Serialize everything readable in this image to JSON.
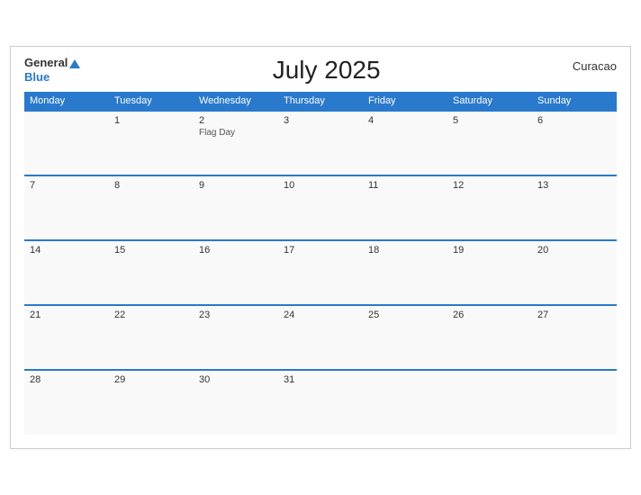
{
  "header": {
    "logo_general": "General",
    "logo_blue": "Blue",
    "title": "July 2025",
    "location": "Curacao"
  },
  "days_of_week": [
    "Monday",
    "Tuesday",
    "Wednesday",
    "Thursday",
    "Friday",
    "Saturday",
    "Sunday"
  ],
  "weeks": [
    [
      {
        "date": "",
        "holiday": ""
      },
      {
        "date": "1",
        "holiday": ""
      },
      {
        "date": "2",
        "holiday": "Flag Day"
      },
      {
        "date": "3",
        "holiday": ""
      },
      {
        "date": "4",
        "holiday": ""
      },
      {
        "date": "5",
        "holiday": ""
      },
      {
        "date": "6",
        "holiday": ""
      }
    ],
    [
      {
        "date": "7",
        "holiday": ""
      },
      {
        "date": "8",
        "holiday": ""
      },
      {
        "date": "9",
        "holiday": ""
      },
      {
        "date": "10",
        "holiday": ""
      },
      {
        "date": "11",
        "holiday": ""
      },
      {
        "date": "12",
        "holiday": ""
      },
      {
        "date": "13",
        "holiday": ""
      }
    ],
    [
      {
        "date": "14",
        "holiday": ""
      },
      {
        "date": "15",
        "holiday": ""
      },
      {
        "date": "16",
        "holiday": ""
      },
      {
        "date": "17",
        "holiday": ""
      },
      {
        "date": "18",
        "holiday": ""
      },
      {
        "date": "19",
        "holiday": ""
      },
      {
        "date": "20",
        "holiday": ""
      }
    ],
    [
      {
        "date": "21",
        "holiday": ""
      },
      {
        "date": "22",
        "holiday": ""
      },
      {
        "date": "23",
        "holiday": ""
      },
      {
        "date": "24",
        "holiday": ""
      },
      {
        "date": "25",
        "holiday": ""
      },
      {
        "date": "26",
        "holiday": ""
      },
      {
        "date": "27",
        "holiday": ""
      }
    ],
    [
      {
        "date": "28",
        "holiday": ""
      },
      {
        "date": "29",
        "holiday": ""
      },
      {
        "date": "30",
        "holiday": ""
      },
      {
        "date": "31",
        "holiday": ""
      },
      {
        "date": "",
        "holiday": ""
      },
      {
        "date": "",
        "holiday": ""
      },
      {
        "date": "",
        "holiday": ""
      }
    ]
  ]
}
